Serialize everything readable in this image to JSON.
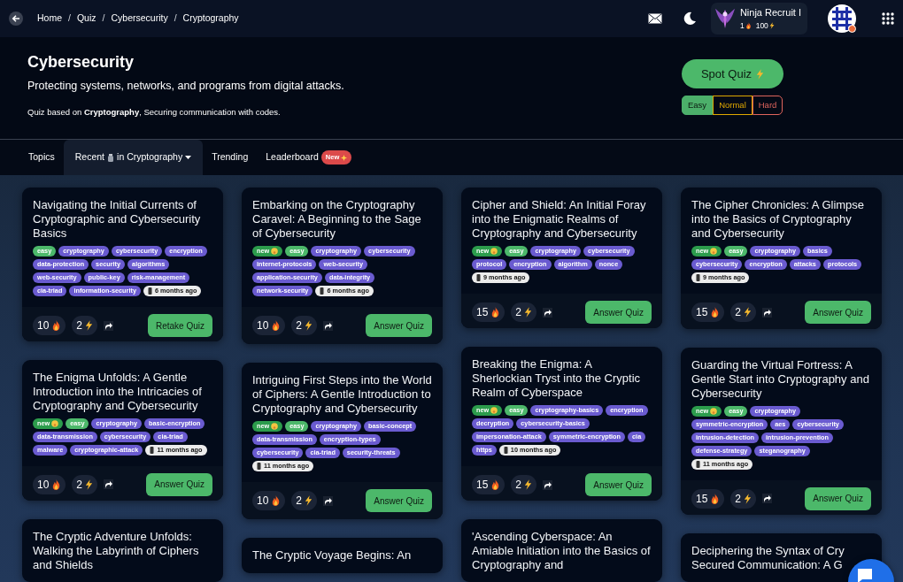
{
  "breadcrumb": [
    {
      "label": "Home"
    },
    {
      "separator": "/",
      "label": "Quiz"
    },
    {
      "separator": "/",
      "label": "Cybersecurity"
    },
    {
      "separator": "/",
      "label": "Cryptography"
    }
  ],
  "profile": {
    "name": "Ninja Recruit I",
    "streak": "1",
    "points": "100"
  },
  "header": {
    "title": "Cybersecurity",
    "subtitle": "Protecting systems, networks, and programs from digital attacks.",
    "note": "Quiz based on **Cryptography**, Securing communication with codes.",
    "spot_button": "Spot Quiz",
    "difficulties": [
      {
        "label": "Easy",
        "selected": true,
        "color": "#4caf6a"
      },
      {
        "label": "Normal",
        "selected": false,
        "color": "#e0a800"
      },
      {
        "label": "Hard",
        "selected": false,
        "color": "#e0645c"
      }
    ]
  },
  "tabs": [
    {
      "label": "Topics",
      "selected": false,
      "kind": "plain"
    },
    {
      "label": "Recent",
      "label_2": "in Cryptography",
      "selected": true,
      "kind": "dropdown"
    },
    {
      "label": "Trending",
      "selected": false,
      "kind": "plain"
    },
    {
      "label": "Leaderboard",
      "badge": "New",
      "selected": false,
      "kind": "badge"
    }
  ],
  "columns": [
    [
      {
        "title": "Navigating the Initial Currents of Cryptographic and Cybersecurity Basics",
        "tags": [
          {
            "label": "easy",
            "kind": "difficulty"
          },
          {
            "label": "cryptography",
            "kind": "topic"
          },
          {
            "label": "cybersecurity",
            "kind": "topic"
          },
          {
            "label": "encryption",
            "kind": "topic"
          },
          {
            "label": "data-protection",
            "kind": "topic"
          },
          {
            "label": "security",
            "kind": "topic"
          },
          {
            "label": "algorithms",
            "kind": "topic"
          },
          {
            "label": "web-security",
            "kind": "topic"
          },
          {
            "label": "public-key",
            "kind": "topic"
          },
          {
            "label": "risk-management",
            "kind": "topic"
          },
          {
            "label": "cia-triad",
            "kind": "topic"
          },
          {
            "label": "information-security",
            "kind": "topic"
          },
          {
            "label": "6 months ago",
            "kind": "time"
          }
        ],
        "fire": "10",
        "energy": "2",
        "button": "Retake Quiz"
      },
      {
        "title": "The Enigma Unfolds: A Gentle Introduction into the Intricacies of Cryptography and Cybersecurity",
        "tags": [
          {
            "label": "new",
            "kind": "new"
          },
          {
            "label": "easy",
            "kind": "difficulty"
          },
          {
            "label": "cryptography",
            "kind": "topic"
          },
          {
            "label": "basic-encryption",
            "kind": "topic"
          },
          {
            "label": "data-transmission",
            "kind": "topic"
          },
          {
            "label": "cybersecurity",
            "kind": "topic"
          },
          {
            "label": "cia-triad",
            "kind": "topic"
          },
          {
            "label": "malware",
            "kind": "topic"
          },
          {
            "label": "cryptographic-attack",
            "kind": "topic"
          },
          {
            "label": "11 months ago",
            "kind": "time"
          }
        ],
        "fire": "10",
        "energy": "2",
        "button": "Answer Quiz"
      },
      {
        "title": "The Cryptic Adventure Unfolds: Walking the Labyrinth of Ciphers and Shields"
      }
    ],
    [
      {
        "title": "Embarking on the Cryptography Caravel: A Beginning to the Sage of Cybersecurity",
        "tags": [
          {
            "label": "new",
            "kind": "new"
          },
          {
            "label": "easy",
            "kind": "difficulty"
          },
          {
            "label": "cryptography",
            "kind": "topic"
          },
          {
            "label": "cybersecurity",
            "kind": "topic"
          },
          {
            "label": "internet-protocols",
            "kind": "topic"
          },
          {
            "label": "web-security",
            "kind": "topic"
          },
          {
            "label": "application-security",
            "kind": "topic"
          },
          {
            "label": "data-integrity",
            "kind": "topic"
          },
          {
            "label": "network-security",
            "kind": "topic"
          },
          {
            "label": "6 months ago",
            "kind": "time"
          }
        ],
        "fire": "10",
        "energy": "2",
        "button": "Answer Quiz"
      },
      {
        "title": "Intriguing First Steps into the World of Ciphers: A Gentle Introduction to Cryptography and Cybersecurity",
        "tags": [
          {
            "label": "new",
            "kind": "new"
          },
          {
            "label": "easy",
            "kind": "difficulty"
          },
          {
            "label": "cryptography",
            "kind": "topic"
          },
          {
            "label": "basic-concept",
            "kind": "topic"
          },
          {
            "label": "data-transmission",
            "kind": "topic"
          },
          {
            "label": "encryption-types",
            "kind": "topic"
          },
          {
            "label": "cybersecurity",
            "kind": "topic"
          },
          {
            "label": "cia-triad",
            "kind": "topic"
          },
          {
            "label": "security-threats",
            "kind": "topic"
          },
          {
            "label": "11 months ago",
            "kind": "time"
          }
        ],
        "fire": "10",
        "energy": "2",
        "button": "Answer Quiz"
      },
      {
        "title": "The Cryptic Voyage Begins: An"
      }
    ],
    [
      {
        "title": "Cipher and Shield: An Initial Foray into the Enigmatic Realms of Cryptography and Cybersecurity",
        "tags": [
          {
            "label": "new",
            "kind": "new"
          },
          {
            "label": "easy",
            "kind": "difficulty"
          },
          {
            "label": "cryptography",
            "kind": "topic"
          },
          {
            "label": "cybersecurity",
            "kind": "topic"
          },
          {
            "label": "protocol",
            "kind": "topic"
          },
          {
            "label": "encryption",
            "kind": "topic"
          },
          {
            "label": "algorithm",
            "kind": "topic"
          },
          {
            "label": "nonce",
            "kind": "topic"
          },
          {
            "label": "9 months ago",
            "kind": "time"
          }
        ],
        "fire": "15",
        "energy": "2",
        "button": "Answer Quiz"
      },
      {
        "title": "Breaking the Enigma: A Sherlockian Tryst into the Cryptic Realm of Cyberspace",
        "tags": [
          {
            "label": "new",
            "kind": "new"
          },
          {
            "label": "easy",
            "kind": "difficulty"
          },
          {
            "label": "cryptography-basics",
            "kind": "topic"
          },
          {
            "label": "encryption",
            "kind": "topic"
          },
          {
            "label": "decryption",
            "kind": "topic"
          },
          {
            "label": "cybersecurity-basics",
            "kind": "topic"
          },
          {
            "label": "impersonation-attack",
            "kind": "topic"
          },
          {
            "label": "symmetric-encryption",
            "kind": "topic"
          },
          {
            "label": "cia",
            "kind": "topic"
          },
          {
            "label": "https",
            "kind": "topic"
          },
          {
            "label": "10 months ago",
            "kind": "time"
          }
        ],
        "fire": "15",
        "energy": "2",
        "button": "Answer Quiz"
      },
      {
        "title": "'Ascending Cyberspace: An Amiable Initiation into the Basics of Cryptography and"
      }
    ],
    [
      {
        "title": "The Cipher Chronicles: A Glimpse into the Basics of Cryptography and Cybersecurity",
        "tags": [
          {
            "label": "new",
            "kind": "new"
          },
          {
            "label": "easy",
            "kind": "difficulty"
          },
          {
            "label": "cryptography",
            "kind": "topic"
          },
          {
            "label": "basics",
            "kind": "topic"
          },
          {
            "label": "cybersecurity",
            "kind": "topic"
          },
          {
            "label": "encryption",
            "kind": "topic"
          },
          {
            "label": "attacks",
            "kind": "topic"
          },
          {
            "label": "protocols",
            "kind": "topic"
          },
          {
            "label": "9 months ago",
            "kind": "time"
          }
        ],
        "fire": "15",
        "energy": "2",
        "button": "Answer Quiz"
      },
      {
        "title": "Guarding the Virtual Fortress: A Gentle Start into Cryptography and Cybersecurity",
        "tags": [
          {
            "label": "new",
            "kind": "new"
          },
          {
            "label": "easy",
            "kind": "difficulty"
          },
          {
            "label": "cryptography",
            "kind": "topic"
          },
          {
            "label": "symmetric-encryption",
            "kind": "topic"
          },
          {
            "label": "aes",
            "kind": "topic"
          },
          {
            "label": "cybersecurity",
            "kind": "topic"
          },
          {
            "label": "intrusion-detection",
            "kind": "topic"
          },
          {
            "label": "intrusion-prevention",
            "kind": "topic"
          },
          {
            "label": "defense-strategy",
            "kind": "topic"
          },
          {
            "label": "steganography",
            "kind": "topic"
          },
          {
            "label": "11 months ago",
            "kind": "time"
          }
        ],
        "fire": "15",
        "energy": "2",
        "button": "Answer Quiz"
      },
      {
        "title_lines": [
          "Deciphering the Syntax of Cry",
          "Secured Communication: A G"
        ]
      }
    ]
  ]
}
